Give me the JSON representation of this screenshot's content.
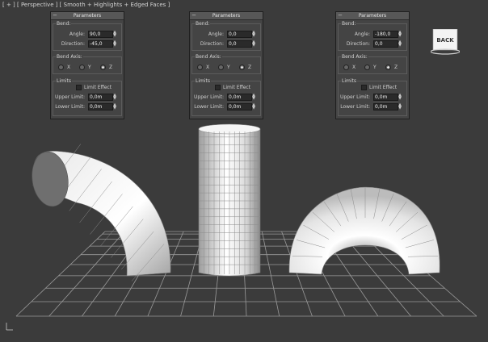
{
  "viewport": {
    "label": "[ + ] [ Perspective ] [ Smooth + Highlights + Edged Faces ]"
  },
  "viewcube": {
    "label": "BACK"
  },
  "panels": [
    {
      "title": "Parameters",
      "bend_group": "Bend:",
      "angle_label": "Angle:",
      "angle_value": "90,0",
      "direction_label": "Direction:",
      "direction_value": "-45,0",
      "axis_group": "Bend Axis:",
      "axes": [
        "X",
        "Y",
        "Z"
      ],
      "selected_axis": "Z",
      "limits_group": "Limits",
      "limit_effect_label": "Limit Effect",
      "upper_label": "Upper Limit:",
      "upper_value": "0,0m",
      "lower_label": "Lower Limit:",
      "lower_value": "0,0m"
    },
    {
      "title": "Parameters",
      "bend_group": "Bend:",
      "angle_label": "Angle:",
      "angle_value": "0,0",
      "direction_label": "Direction:",
      "direction_value": "0,0",
      "axis_group": "Bend Axis:",
      "axes": [
        "X",
        "Y",
        "Z"
      ],
      "selected_axis": "Z",
      "limits_group": "Limits",
      "limit_effect_label": "Limit Effect",
      "upper_label": "Upper Limit:",
      "upper_value": "0,0m",
      "lower_label": "Lower Limit:",
      "lower_value": "0,0m"
    },
    {
      "title": "Parameters",
      "bend_group": "Bend:",
      "angle_label": "Angle:",
      "angle_value": "-180,0",
      "direction_label": "Direction:",
      "direction_value": "0,0",
      "axis_group": "Bend Axis:",
      "axes": [
        "X",
        "Y",
        "Z"
      ],
      "selected_axis": "Z",
      "limits_group": "Limits",
      "limit_effect_label": "Limit Effect",
      "upper_label": "Upper Limit:",
      "upper_value": "0,0m",
      "lower_label": "Lower Limit:",
      "lower_value": "0,0m"
    }
  ],
  "status": {
    "axis_indicator": "L"
  },
  "colors": {
    "background": "#3b3b3b",
    "grid": "#9a9a9a",
    "panel": "#444444",
    "field": "#2a2a2a",
    "mesh": "#f2f2f2"
  }
}
